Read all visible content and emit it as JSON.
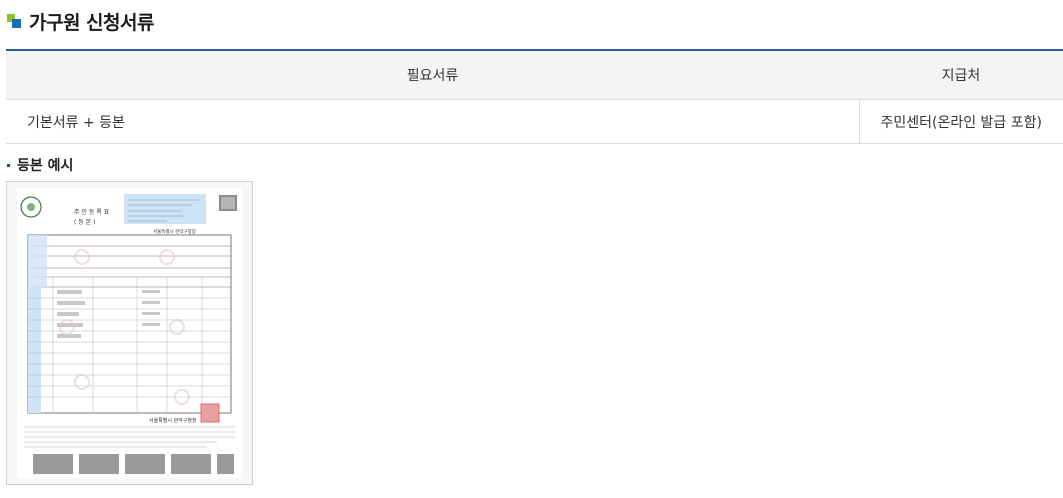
{
  "page": {
    "title": "가구원 신청서류"
  },
  "table": {
    "headers": [
      "필요서류",
      "지급처"
    ],
    "rows": [
      {
        "document": "기본서류 + 등본",
        "issuer": "주민센터(온라인 발급 포함)"
      }
    ]
  },
  "example": {
    "title": "등본 예시",
    "doc_heading": "주 민 등 록 표",
    "doc_subheading": "( 등 본 )",
    "doc_office": "서울특별시 관악구청장",
    "colors": {
      "header_border": "#2b5c8a",
      "highlight_blue": "#cfe3f7",
      "stamp_red": "#d9534f"
    }
  }
}
